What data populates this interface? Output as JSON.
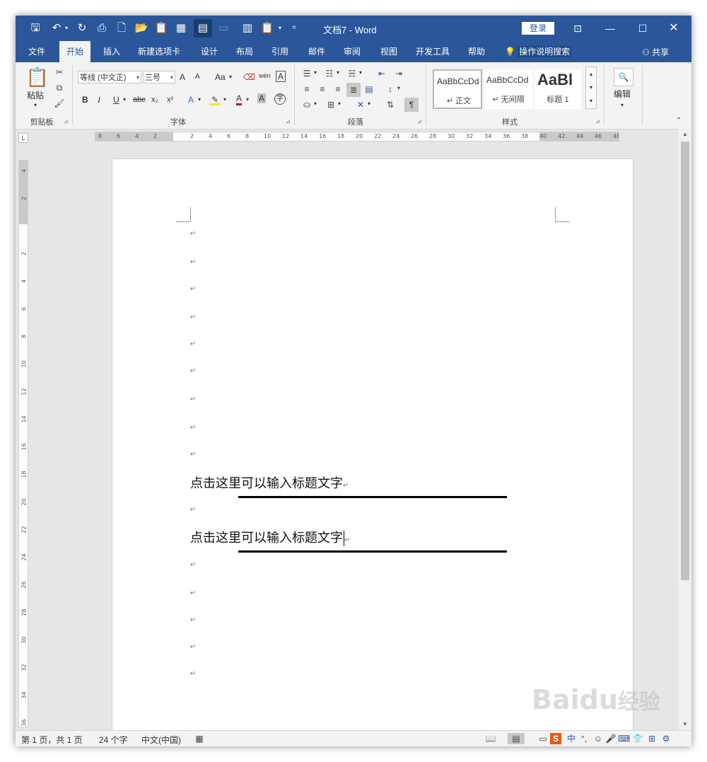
{
  "titlebar": {
    "doc_title": "文档7",
    "separator": "-",
    "app_name": "Word",
    "login_label": "登录"
  },
  "tabs": [
    {
      "label": "文件",
      "active": false
    },
    {
      "label": "开始",
      "active": true
    },
    {
      "label": "插入",
      "active": false
    },
    {
      "label": "新建选项卡",
      "active": false
    },
    {
      "label": "设计",
      "active": false
    },
    {
      "label": "布局",
      "active": false
    },
    {
      "label": "引用",
      "active": false
    },
    {
      "label": "邮件",
      "active": false
    },
    {
      "label": "审阅",
      "active": false
    },
    {
      "label": "视图",
      "active": false
    },
    {
      "label": "开发工具",
      "active": false
    },
    {
      "label": "帮助",
      "active": false
    }
  ],
  "tell_me": "操作说明搜索",
  "share": "共享",
  "ribbon": {
    "clipboard": {
      "paste_label": "粘贴",
      "group_label": "剪贴板"
    },
    "font": {
      "font_name": "等线 (中文正)",
      "font_size": "三号",
      "grow": "A",
      "shrink": "A",
      "case": "Aa",
      "bold": "B",
      "italic": "I",
      "underline": "U",
      "strike": "abc",
      "subscript": "x₂",
      "superscript": "x²",
      "text_effects": "A",
      "font_color": "A",
      "char_shading": "A",
      "enclose": "字",
      "phonetic": "wén",
      "border": "A",
      "group_label": "字体"
    },
    "paragraph": {
      "group_label": "段落"
    },
    "styles": {
      "items": [
        {
          "sample": "AaBbCcDd",
          "name": "↵ 正文"
        },
        {
          "sample": "AaBbCcDd",
          "name": "↵ 无间隔"
        },
        {
          "sample": "AaBl",
          "name": "标题 1"
        }
      ],
      "group_label": "样式"
    },
    "editing": {
      "label": "编辑"
    }
  },
  "ruler": {
    "corner": "L",
    "h_ticks": [
      "8",
      "6",
      "4",
      "2",
      "",
      "2",
      "4",
      "6",
      "8",
      "10",
      "12",
      "14",
      "16",
      "18",
      "20",
      "22",
      "24",
      "26",
      "28",
      "30",
      "32",
      "34",
      "36",
      "38",
      "40",
      "42",
      "44",
      "46",
      "48"
    ],
    "v_ticks": [
      "4",
      "2",
      "",
      "2",
      "4",
      "6",
      "8",
      "10",
      "12",
      "14",
      "16",
      "18",
      "20",
      "22",
      "24",
      "26",
      "28",
      "30",
      "32",
      "34",
      "36"
    ]
  },
  "document": {
    "paragraph_mark": "↵",
    "heading1": "点击这里可以输入标题文字",
    "heading2": "点击这里可以输入标题文字"
  },
  "status": {
    "page": "第 1 页，共 1 页",
    "words": "24 个字",
    "language": "中文(中国)"
  },
  "watermark": {
    "text": "Baidu",
    "suffix": "经验"
  }
}
